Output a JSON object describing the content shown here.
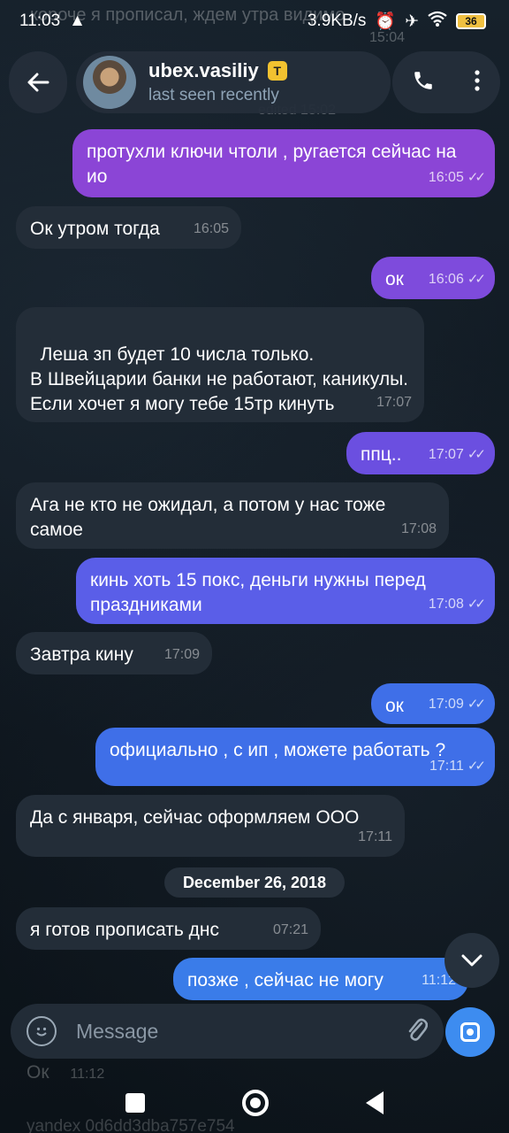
{
  "status_bar": {
    "time": "11:03",
    "warning_icon": "warning-icon",
    "speed": "3.9KB/s",
    "battery": "36"
  },
  "ghost": {
    "top_text": "короче я прописал, ждем утра видимо",
    "top_time": "15:04",
    "edited": "edited 15:02",
    "bottom_text": "Ок",
    "bottom_time": "11:12",
    "bottom2": "yandex 0d6dd3dba757e754"
  },
  "header": {
    "name": "ubex.vasiliy",
    "badge": "T",
    "status": "last seen recently"
  },
  "messages": [
    {
      "dir": "out",
      "text": "протухли ключи чтоли , ругается сейчас на ио",
      "time": "16:05"
    },
    {
      "dir": "in",
      "text": "Ок утром тогда",
      "time": "16:05"
    },
    {
      "dir": "out",
      "text": "ок",
      "time": "16:06"
    },
    {
      "dir": "in",
      "text": "Леша зп будет 10 числа только.\nВ Швейцарии банки не работают, каникулы. Если хочет я могу тебе 15тр кинуть",
      "time": "17:07"
    },
    {
      "dir": "out",
      "text": "ппц..",
      "time": "17:07"
    },
    {
      "dir": "in",
      "text": "Ага не кто не ожидал, а потом у нас тоже самое",
      "time": "17:08"
    },
    {
      "dir": "out",
      "text": "кинь хоть 15 покс, деньги нужны перед праздниками",
      "time": "17:08"
    },
    {
      "dir": "in",
      "text": "Завтра кину",
      "time": "17:09"
    },
    {
      "dir": "out",
      "text": "ок",
      "time": "17:09"
    },
    {
      "dir": "out",
      "text": "официально , с ип , можете работать ?",
      "time": "17:11"
    },
    {
      "dir": "in",
      "text": "Да с января, сейчас оформляем ООО",
      "time": "17:11"
    },
    {
      "dir": "in",
      "text": "я готов прописать днс",
      "time": "07:21"
    },
    {
      "dir": "out",
      "text": "позже , сейчас не могу",
      "time": "11:12"
    }
  ],
  "date_chip": "December 26, 2018",
  "input": {
    "placeholder": "Message"
  },
  "colors": {
    "background": "#111a22",
    "incoming": "#232d38",
    "outgoing_purple": "#8b45d6",
    "outgoing_blue": "#3f6fe8",
    "camera_button": "#3d8cf0"
  }
}
